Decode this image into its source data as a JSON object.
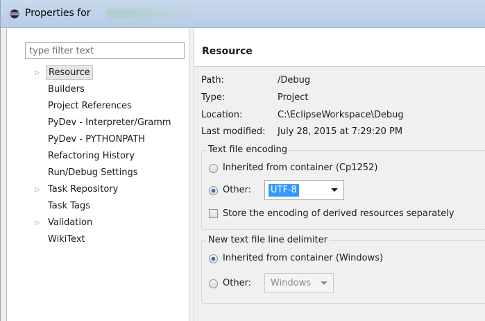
{
  "window": {
    "title": "Properties for"
  },
  "sidebar": {
    "filter_placeholder": "type filter text",
    "items": [
      {
        "label": "Resource",
        "expandable": true,
        "selected": true
      },
      {
        "label": "Builders",
        "expandable": false
      },
      {
        "label": "Project References",
        "expandable": false
      },
      {
        "label": "PyDev - Interpreter/Gramm",
        "expandable": false
      },
      {
        "label": "PyDev - PYTHONPATH",
        "expandable": false
      },
      {
        "label": "Refactoring History",
        "expandable": false
      },
      {
        "label": "Run/Debug Settings",
        "expandable": false
      },
      {
        "label": "Task Repository",
        "expandable": true
      },
      {
        "label": "Task Tags",
        "expandable": false
      },
      {
        "label": "Validation",
        "expandable": true
      },
      {
        "label": "WikiText",
        "expandable": false
      }
    ]
  },
  "page": {
    "title": "Resource",
    "info": [
      {
        "key": "Path:",
        "value": "/Debug"
      },
      {
        "key": "Type:",
        "value": "Project"
      },
      {
        "key": "Location:",
        "value": "C:\\EclipseWorkspace\\Debug"
      },
      {
        "key": "Last modified:",
        "value": "July 28, 2015 at 7:29:20 PM"
      }
    ],
    "encoding": {
      "group_title": "Text file encoding",
      "inherited_label": "Inherited from container (Cp1252)",
      "other_label": "Other:",
      "other_value": "UTF-8",
      "store_derived_label": "Store the encoding of derived resources separately",
      "selected": "other"
    },
    "delimiter": {
      "group_title": "New text file line delimiter",
      "inherited_label": "Inherited from container (Windows)",
      "other_label": "Other:",
      "other_value": "Windows",
      "selected": "inherited"
    }
  },
  "colors": {
    "selection_highlight": "#3399ff",
    "radio_selected": "#2b67b8"
  }
}
